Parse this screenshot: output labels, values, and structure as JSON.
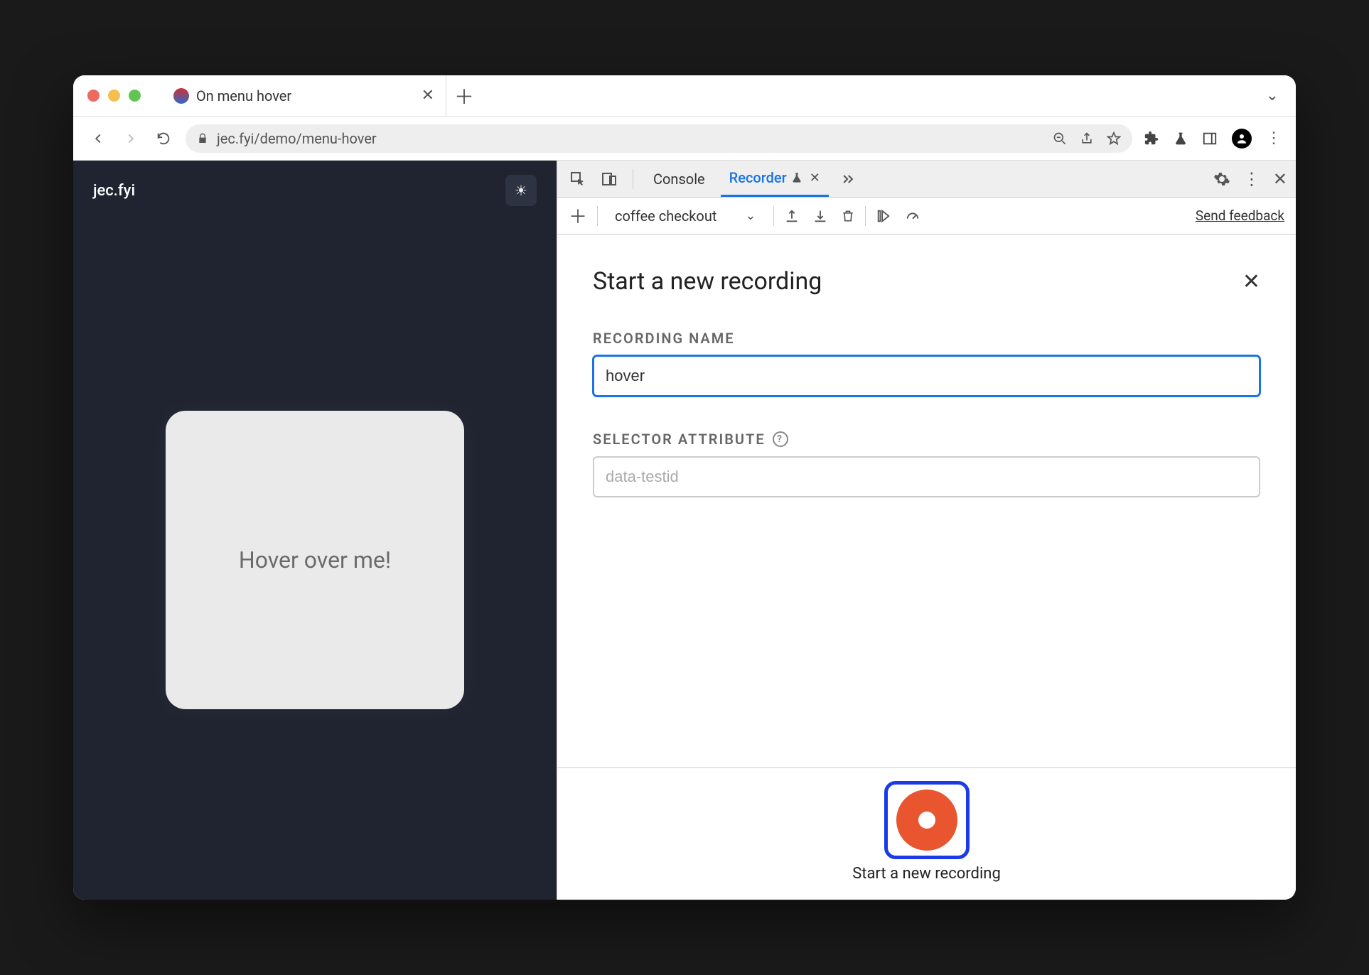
{
  "browser": {
    "tab_title": "On menu hover",
    "url": "jec.fyi/demo/menu-hover"
  },
  "page": {
    "brand": "jec.fyi",
    "card_text": "Hover over me!"
  },
  "devtools": {
    "tabs": {
      "console": "Console",
      "recorder": "Recorder"
    },
    "toolbar": {
      "recording_select": "coffee checkout",
      "feedback": "Send feedback"
    },
    "panel": {
      "title": "Start a new recording",
      "name_label": "RECORDING NAME",
      "name_value": "hover",
      "selector_label": "SELECTOR ATTRIBUTE",
      "selector_placeholder": "data-testid",
      "record_label": "Start a new recording"
    }
  }
}
